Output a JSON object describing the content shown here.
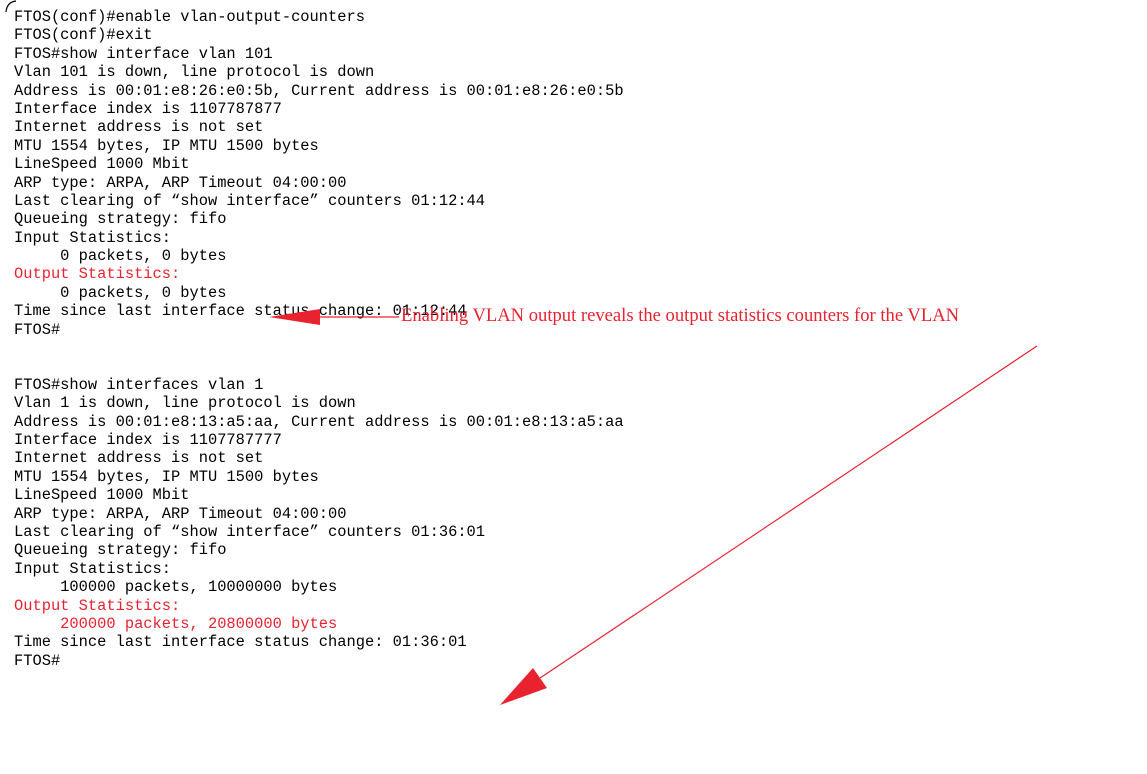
{
  "block1": {
    "lines": [
      {
        "text": "FTOS(conf)#enable vlan-output-counters",
        "highlight": false
      },
      {
        "text": "FTOS(conf)#exit",
        "highlight": false
      },
      {
        "text": "FTOS#show interface vlan 101",
        "highlight": false
      },
      {
        "text": "Vlan 101 is down, line protocol is down",
        "highlight": false
      },
      {
        "text": "Address is 00:01:e8:26:e0:5b, Current address is 00:01:e8:26:e0:5b",
        "highlight": false
      },
      {
        "text": "Interface index is 1107787877",
        "highlight": false
      },
      {
        "text": "Internet address is not set",
        "highlight": false
      },
      {
        "text": "MTU 1554 bytes, IP MTU 1500 bytes",
        "highlight": false
      },
      {
        "text": "LineSpeed 1000 Mbit",
        "highlight": false
      },
      {
        "text": "ARP type: ARPA, ARP Timeout 04:00:00",
        "highlight": false
      },
      {
        "text": "Last clearing of “show interface” counters 01:12:44",
        "highlight": false
      },
      {
        "text": "Queueing strategy: fifo",
        "highlight": false
      },
      {
        "text": "Input Statistics:",
        "highlight": false
      },
      {
        "text": "     0 packets, 0 bytes",
        "highlight": false
      },
      {
        "text": "Output Statistics:",
        "highlight": true
      },
      {
        "text": "     0 packets, 0 bytes",
        "highlight": false
      },
      {
        "text": "Time since last interface status change: 01:12:44",
        "highlight": false
      },
      {
        "text": "FTOS#",
        "highlight": false
      }
    ]
  },
  "block2": {
    "lines": [
      {
        "text": "FTOS#show interfaces vlan 1",
        "highlight": false
      },
      {
        "text": "Vlan 1 is down, line protocol is down",
        "highlight": false
      },
      {
        "text": "Address is 00:01:e8:13:a5:aa, Current address is 00:01:e8:13:a5:aa",
        "highlight": false
      },
      {
        "text": "Interface index is 1107787777",
        "highlight": false
      },
      {
        "text": "Internet address is not set",
        "highlight": false
      },
      {
        "text": "MTU 1554 bytes, IP MTU 1500 bytes",
        "highlight": false
      },
      {
        "text": "LineSpeed 1000 Mbit",
        "highlight": false
      },
      {
        "text": "ARP type: ARPA, ARP Timeout 04:00:00",
        "highlight": false
      },
      {
        "text": "Last clearing of “show interface” counters 01:36:01",
        "highlight": false
      },
      {
        "text": "Queueing strategy: fifo",
        "highlight": false
      },
      {
        "text": "Input Statistics:",
        "highlight": false
      },
      {
        "text": "     100000 packets, 10000000 bytes",
        "highlight": false
      },
      {
        "text": "Output Statistics:",
        "highlight": true
      },
      {
        "text": "     200000 packets, 20800000 bytes",
        "highlight": true
      },
      {
        "text": "Time since last interface status change: 01:36:01",
        "highlight": false
      },
      {
        "text": "FTOS#",
        "highlight": false
      }
    ]
  },
  "callout": {
    "text": "Enabling VLAN output reveals the output statistics counters for the VLAN"
  },
  "colors": {
    "text": "#000000",
    "highlight": "#e8232f"
  }
}
